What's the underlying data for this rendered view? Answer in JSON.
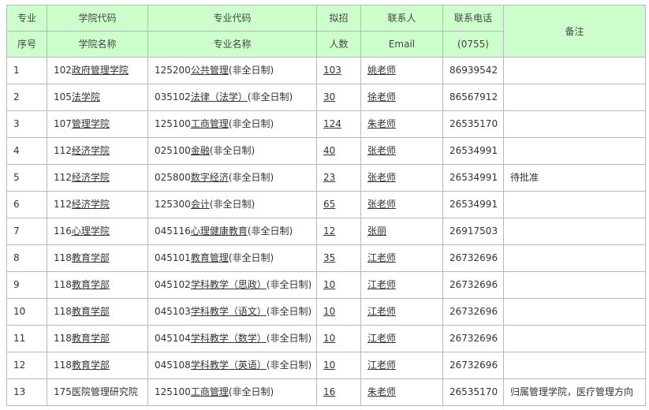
{
  "header": {
    "seq": [
      "专业",
      "序号"
    ],
    "college": [
      "学院代码",
      "学院名称"
    ],
    "major": [
      "专业代码",
      "专业名称"
    ],
    "enroll": [
      "拟招",
      "人数"
    ],
    "contact": [
      "联系人",
      "Email"
    ],
    "phone": [
      "联系电话",
      "(0755)"
    ],
    "remark": "备注"
  },
  "rows": [
    {
      "seq": "1",
      "college_code": "102",
      "college_name": "政府管理学院",
      "major_code": "125200",
      "major_name": "公共管理",
      "mode": "(非全日制)",
      "enroll": "103",
      "contact": "姚老师",
      "phone": "86939542",
      "remark": ""
    },
    {
      "seq": "2",
      "college_code": "105",
      "college_name": "法学院",
      "major_code": "035102",
      "major_name": "法律（法学）",
      "mode": "(非全日制)",
      "enroll": "30",
      "contact": "徐老师",
      "phone": "86567912",
      "remark": ""
    },
    {
      "seq": "3",
      "college_code": "107",
      "college_name": "管理学院",
      "major_code": "125100",
      "major_name": "工商管理",
      "mode": "(非全日制)",
      "enroll": "124",
      "contact": "朱老师",
      "phone": "26535170",
      "remark": ""
    },
    {
      "seq": "4",
      "college_code": "112",
      "college_name": "经济学院",
      "major_code": "025100",
      "major_name": "金融",
      "mode": "(非全日制)",
      "enroll": "40",
      "contact": "张老师",
      "phone": "26534991",
      "remark": ""
    },
    {
      "seq": "5",
      "college_code": "112",
      "college_name": "经济学院",
      "major_code": "025800",
      "major_name": "数字经济",
      "mode": "(非全日制)",
      "enroll": "23",
      "contact": "张老师",
      "phone": "26534991",
      "remark": "待批准"
    },
    {
      "seq": "6",
      "college_code": "112",
      "college_name": "经济学院",
      "major_code": "125300",
      "major_name": "会计",
      "mode": "(非全日制)",
      "enroll": "65",
      "contact": "张老师",
      "phone": "26534991",
      "remark": ""
    },
    {
      "seq": "7",
      "college_code": "116",
      "college_name": "心理学院",
      "major_code": "045116",
      "major_name": "心理健康教育",
      "mode": "(非全日制)",
      "enroll": "12",
      "contact": "张丽",
      "phone": "26917503",
      "remark": ""
    },
    {
      "seq": "8",
      "college_code": "118",
      "college_name": "教育学部",
      "major_code": "045101",
      "major_name": "教育管理",
      "mode": "(非全日制)",
      "enroll": "35",
      "contact": "江老师",
      "phone": "26732696",
      "remark": ""
    },
    {
      "seq": "9",
      "college_code": "118",
      "college_name": "教育学部",
      "major_code": "045102",
      "major_name": "学科教学（思政）",
      "mode": "(非全日制)",
      "enroll": "10",
      "contact": "江老师",
      "phone": "26732696",
      "remark": ""
    },
    {
      "seq": "10",
      "college_code": "118",
      "college_name": "教育学部",
      "major_code": "045103",
      "major_name": "学科教学（语文）",
      "mode": "(非全日制)",
      "enroll": "10",
      "contact": "江老师",
      "phone": "26732696",
      "remark": ""
    },
    {
      "seq": "11",
      "college_code": "118",
      "college_name": "教育学部",
      "major_code": "045104",
      "major_name": "学科教学（数学）",
      "mode": "(非全日制)",
      "enroll": "10",
      "contact": "江老师",
      "phone": "26732696",
      "remark": ""
    },
    {
      "seq": "12",
      "college_code": "118",
      "college_name": "教育学部",
      "major_code": "045108",
      "major_name": "学科教学（英语）",
      "mode": "(非全日制)",
      "enroll": "10",
      "contact": "江老师",
      "phone": "26732696",
      "remark": ""
    },
    {
      "seq": "13",
      "college_code": "175",
      "college_name": "医院管理研究院",
      "major_code": "125100",
      "major_name": "工商管理",
      "mode": "(非全日制)",
      "enroll": "16",
      "contact": "朱老师",
      "phone": "26535170",
      "remark": "归属管理学院，医疗管理方向"
    }
  ],
  "colors": {
    "header_bg": "#ccffcc",
    "border": "#b8b8b8",
    "text": "#333333"
  }
}
